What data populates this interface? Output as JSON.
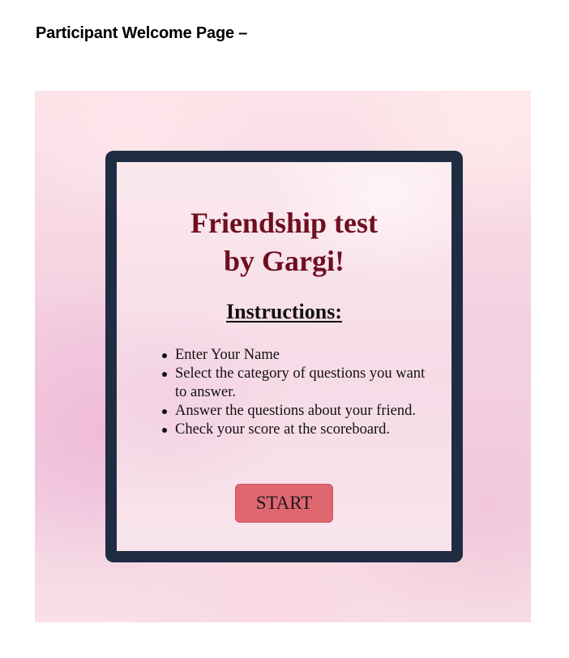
{
  "document": {
    "heading": "Participant Welcome Page –"
  },
  "app": {
    "title_line1": "Friendship test",
    "title_line2": "by Gargi!",
    "instructions_heading": "Instructions:",
    "instructions": [
      "Enter Your Name",
      "Select the category of questions you want to answer.",
      "Answer the questions about your friend.",
      "Check your score at the scoreboard."
    ],
    "start_label": "START"
  },
  "colors": {
    "title": "#6e0f1f",
    "frame": "#1f2d42",
    "start_button": "#e06670"
  }
}
